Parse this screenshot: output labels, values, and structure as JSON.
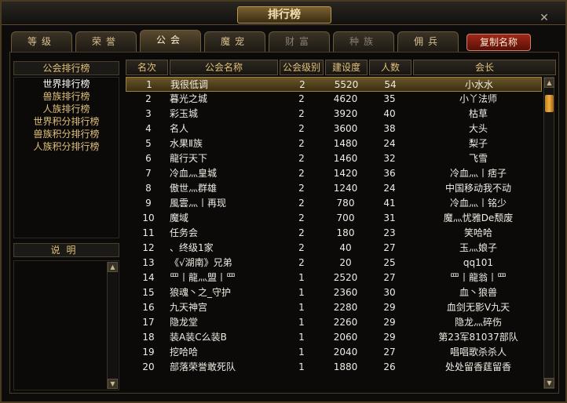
{
  "window": {
    "title": "排行榜",
    "close_label": "✕"
  },
  "tabs": [
    {
      "label": "等级"
    },
    {
      "label": "荣誉"
    },
    {
      "label": "公会"
    },
    {
      "label": "魔宠"
    },
    {
      "label": "财富"
    },
    {
      "label": "种族"
    },
    {
      "label": "佣兵"
    }
  ],
  "toolbar": {
    "copy_name_label": "复制名称"
  },
  "sidebar": {
    "header": "公会排行榜",
    "items": [
      {
        "label": "世界排行榜"
      },
      {
        "label": "兽族排行榜"
      },
      {
        "label": "人族排行榜"
      },
      {
        "label": "世界积分排行榜"
      },
      {
        "label": "兽族积分排行榜"
      },
      {
        "label": "人族积分排行榜"
      }
    ],
    "desc_header": "说明",
    "scroll_up": "▲",
    "scroll_down": "▼"
  },
  "table": {
    "columns": [
      "名次",
      "公会名称",
      "公会级别",
      "建设度",
      "人数",
      "会长"
    ],
    "rows": [
      {
        "rank": "1",
        "name": "我很低调",
        "level": "2",
        "build": "5520",
        "members": "54",
        "leader": "小水水"
      },
      {
        "rank": "2",
        "name": "暮光之城",
        "level": "2",
        "build": "4620",
        "members": "35",
        "leader": "小丫法师"
      },
      {
        "rank": "3",
        "name": "彩玉城",
        "level": "2",
        "build": "3920",
        "members": "40",
        "leader": "枯草"
      },
      {
        "rank": "4",
        "name": "名人",
        "level": "2",
        "build": "3600",
        "members": "38",
        "leader": "大头"
      },
      {
        "rank": "5",
        "name": "水果Ⅱ族",
        "level": "2",
        "build": "1480",
        "members": "24",
        "leader": "梨子"
      },
      {
        "rank": "6",
        "name": "龍行天下",
        "level": "2",
        "build": "1460",
        "members": "32",
        "leader": "飞雪"
      },
      {
        "rank": "7",
        "name": "冷血灬皇城",
        "level": "2",
        "build": "1420",
        "members": "36",
        "leader": "冷血灬丨痞子"
      },
      {
        "rank": "8",
        "name": "傲世灬群雄",
        "level": "2",
        "build": "1240",
        "members": "24",
        "leader": "中国移动我不动"
      },
      {
        "rank": "9",
        "name": "風雲灬丨再现",
        "level": "2",
        "build": "780",
        "members": "41",
        "leader": "冷血灬丨铭少"
      },
      {
        "rank": "10",
        "name": "魔域",
        "level": "2",
        "build": "700",
        "members": "31",
        "leader": "魔灬忧雅De颓废"
      },
      {
        "rank": "11",
        "name": "任务会",
        "level": "2",
        "build": "180",
        "members": "23",
        "leader": "笑哈哈"
      },
      {
        "rank": "12",
        "name": "、终级1家",
        "level": "2",
        "build": "40",
        "members": "27",
        "leader": "玉灬娘子"
      },
      {
        "rank": "13",
        "name": "《√湖南》兄弟",
        "level": "2",
        "build": "20",
        "members": "25",
        "leader": "qq101"
      },
      {
        "rank": "14",
        "name": "罒丨龍灬盟丨罒",
        "level": "1",
        "build": "2520",
        "members": "27",
        "leader": "罒丨龍翁丨罒"
      },
      {
        "rank": "15",
        "name": "狼魂丶之_守护",
        "level": "1",
        "build": "2360",
        "members": "30",
        "leader": "血丶狼兽"
      },
      {
        "rank": "16",
        "name": "九天神宫",
        "level": "1",
        "build": "2280",
        "members": "29",
        "leader": "血剑无影V九天"
      },
      {
        "rank": "17",
        "name": "隐龙堂",
        "level": "1",
        "build": "2260",
        "members": "29",
        "leader": "隐龙灬碎伤"
      },
      {
        "rank": "18",
        "name": "装A装C么装B",
        "level": "1",
        "build": "2060",
        "members": "29",
        "leader": "第23军81037部队"
      },
      {
        "rank": "19",
        "name": "挖哈哈",
        "level": "1",
        "build": "2040",
        "members": "27",
        "leader": "唱唱歌杀杀人"
      },
      {
        "rank": "20",
        "name": "部落荣誉敢死队",
        "level": "1",
        "build": "1880",
        "members": "26",
        "leader": "处处留香莛留香"
      }
    ]
  }
}
